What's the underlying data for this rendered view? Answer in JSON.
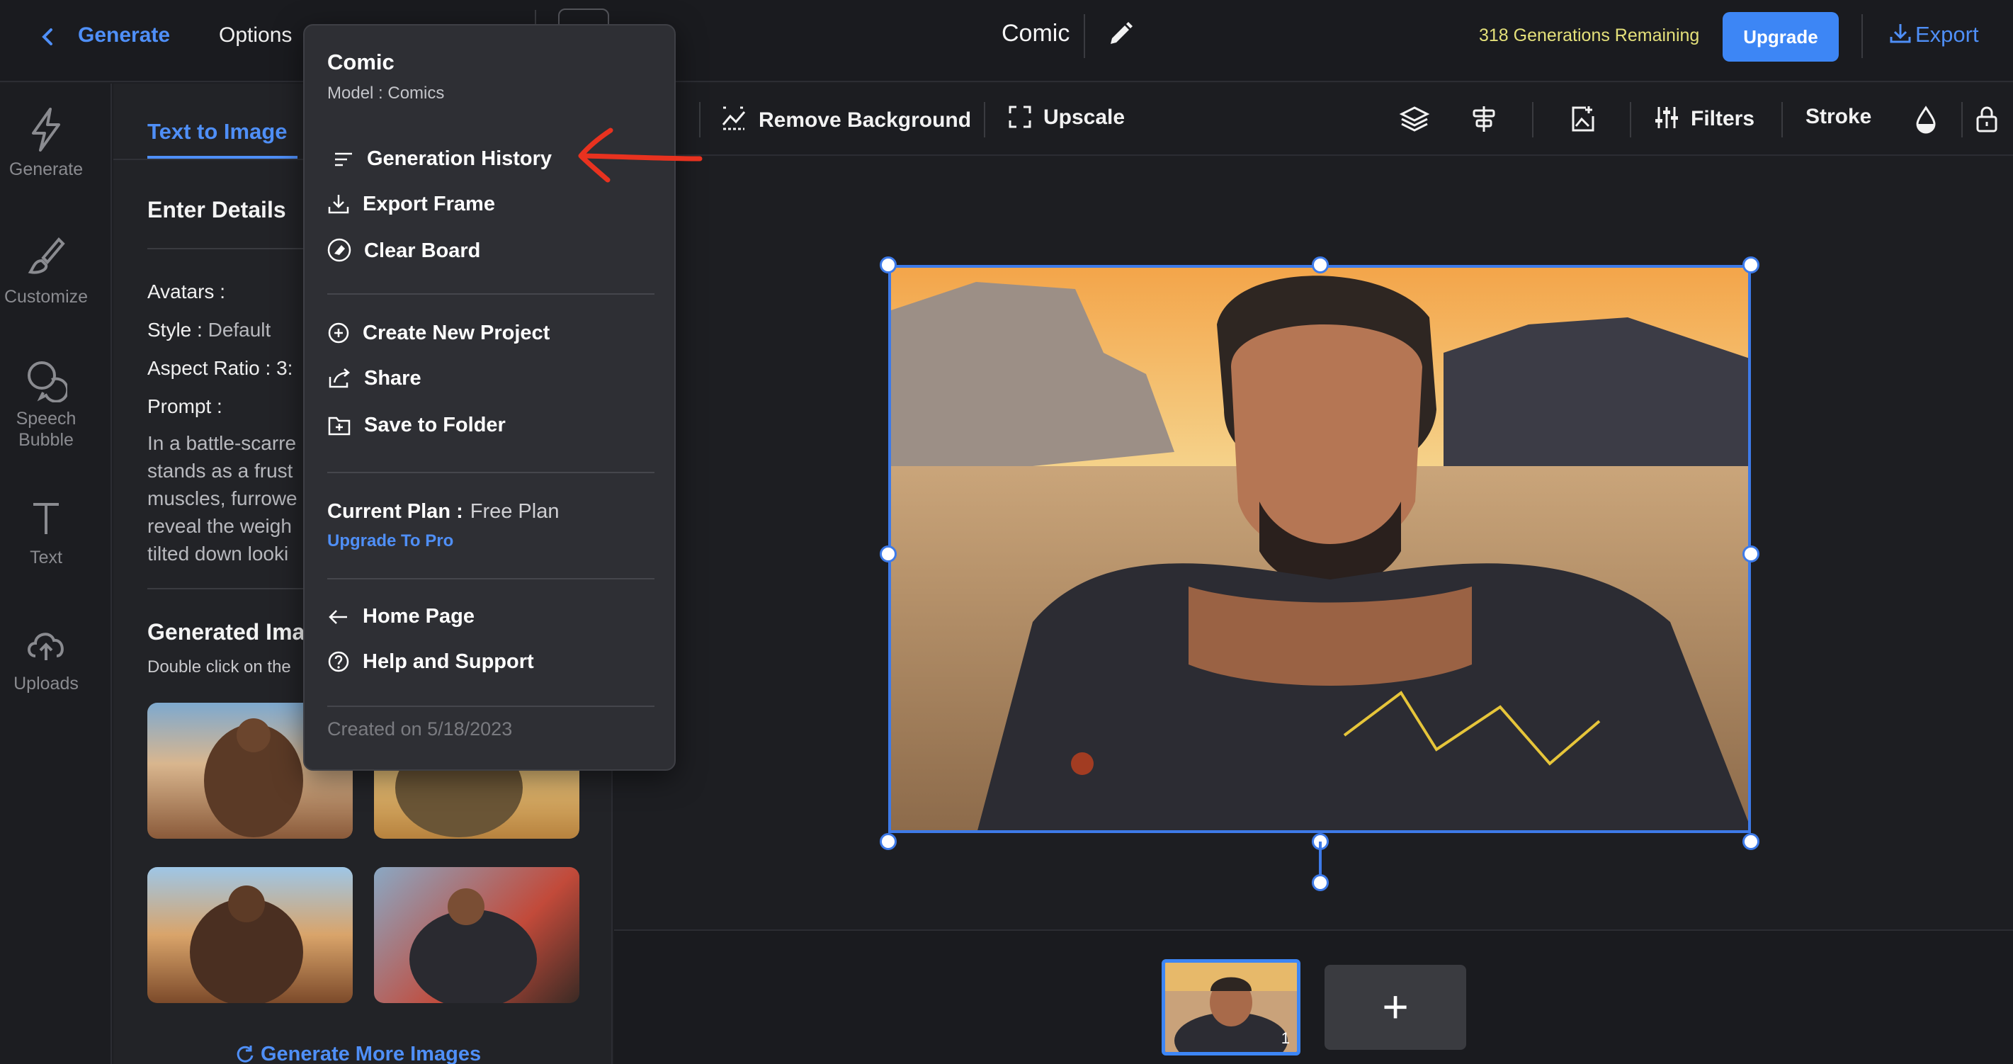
{
  "topbar": {
    "generate_label": "Generate",
    "options_label": "Options",
    "project_title": "Comic",
    "remaining": "318 Generations Remaining",
    "upgrade_label": "Upgrade",
    "export_label": "Export"
  },
  "rail": {
    "items": [
      {
        "label": "Generate",
        "icon": "lightning-icon"
      },
      {
        "label": "Customize",
        "icon": "brush-icon"
      },
      {
        "label": "Speech Bubble",
        "icon": "speech-bubble-icon"
      },
      {
        "label": "Text",
        "icon": "text-icon"
      },
      {
        "label": "Uploads",
        "icon": "cloud-upload-icon"
      }
    ]
  },
  "panel": {
    "tab_label": "Text to Image",
    "details_heading": "Enter Details",
    "avatars_key": "Avatars :",
    "style_key": "Style :",
    "style_value": "Default",
    "aspect_key": "Aspect Ratio : 3:",
    "prompt_key": "Prompt :",
    "prompt_lines": [
      "In a battle-scarre",
      "stands as a frust",
      "muscles, furrowe",
      "reveal the weigh",
      "tilted down looki"
    ],
    "generated_heading": "Generated Ima",
    "generated_sub": "Double click on the",
    "more_label": "Generate More Images"
  },
  "toolbar": {
    "remove_bg_label": "Remove Background",
    "upscale_label": "Upscale",
    "filters_label": "Filters",
    "stroke_label": "Stroke"
  },
  "pages": {
    "current_number": "1",
    "add_label": "+"
  },
  "menu": {
    "title": "Comic",
    "model": "Model : Comics",
    "items_group1": [
      "Generation History",
      "Export Frame",
      "Clear Board"
    ],
    "items_group2": [
      "Create New Project",
      "Share",
      "Save to Folder"
    ],
    "plan_key": "Current Plan :",
    "plan_value": "Free Plan",
    "upgrade_to_pro": "Upgrade To Pro",
    "items_group3": [
      "Home Page",
      "Help and Support"
    ],
    "created": "Created on 5/18/2023"
  },
  "colors": {
    "accent": "#4f8ff7",
    "selection": "#3d7ae8",
    "remaining_text": "#e4e07a",
    "annotation_arrow": "#e8321f"
  }
}
